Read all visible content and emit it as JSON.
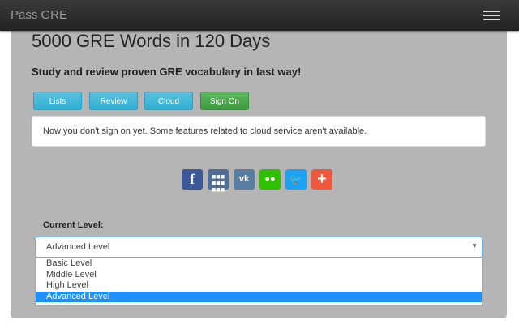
{
  "nav": {
    "brand": "Pass GRE",
    "menu_icon": "hamburger-icon"
  },
  "main": {
    "title": "5000 GRE Words in 120 Days",
    "subtitle": "Study and review proven GRE vocabulary in fast way!",
    "buttons": [
      {
        "label": "Lists"
      },
      {
        "label": "Review"
      },
      {
        "label": "Cloud"
      },
      {
        "label": "Sign On"
      }
    ],
    "alert": "Now you don't sign on yet. Some features related to cloud service aren't available.",
    "social": [
      {
        "name": "facebook",
        "glyph": "f",
        "color": "#3b5998"
      },
      {
        "name": "apps",
        "glyph": "⋮⋮⋮",
        "color": "#4f6f99"
      },
      {
        "name": "vk",
        "glyph": "vk",
        "color": "#587ea3"
      },
      {
        "name": "wechat",
        "glyph": "●●",
        "color": "#2dc100"
      },
      {
        "name": "twitter",
        "glyph": "🐦",
        "color": "#1da1f2"
      },
      {
        "name": "more",
        "glyph": "+",
        "color": "#f0583e"
      }
    ],
    "level_label": "Current Level:",
    "level_selected": "Advanced Level",
    "level_options": [
      "Basic Level",
      "Middle Level",
      "High Level",
      "Advanced Level"
    ]
  }
}
